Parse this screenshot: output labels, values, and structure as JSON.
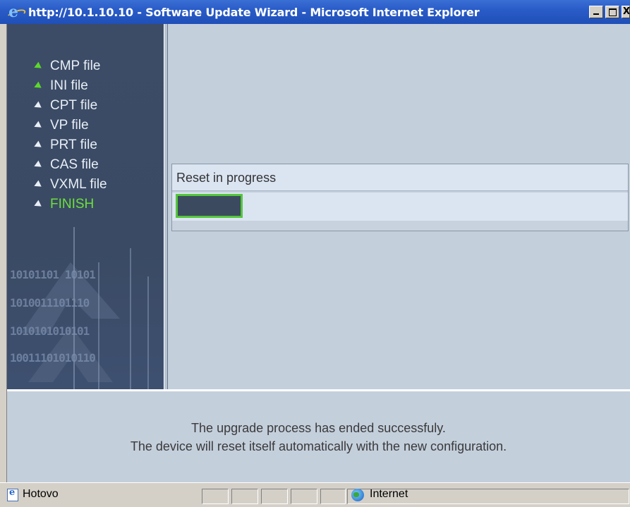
{
  "window": {
    "title": "http://10.1.10.10 - Software Update Wizard - Microsoft Internet Explorer",
    "close_glyph": "X"
  },
  "sidebar": {
    "items": [
      {
        "label": "CMP file",
        "state": "done"
      },
      {
        "label": "INI file",
        "state": "done"
      },
      {
        "label": "CPT file",
        "state": "pending"
      },
      {
        "label": "VP file",
        "state": "pending"
      },
      {
        "label": "PRT file",
        "state": "pending"
      },
      {
        "label": "CAS file",
        "state": "pending"
      },
      {
        "label": "VXML file",
        "state": "pending"
      },
      {
        "label": "FINISH",
        "state": "current"
      }
    ],
    "decoration_bits": [
      "10101101 10101",
      "1010011101110",
      "1010101010101",
      "10011101010110"
    ]
  },
  "main": {
    "status_text": "Reset in progress",
    "progress": 0.15
  },
  "message": {
    "line1": "The upgrade process has ended successfuly.",
    "line2": "The device will reset itself automatically with the new configuration."
  },
  "statusbar": {
    "status": "Hotovo",
    "zone": "Internet"
  },
  "colors": {
    "sidebar_bg": "#3c4c66",
    "accent_green": "#54c73a",
    "panel_bg": "#c4cfdc",
    "title_bar": "#2a5cc8"
  },
  "icons": {
    "app": "internet-explorer-icon",
    "status_page": "page-icon",
    "zone": "globe-icon"
  }
}
